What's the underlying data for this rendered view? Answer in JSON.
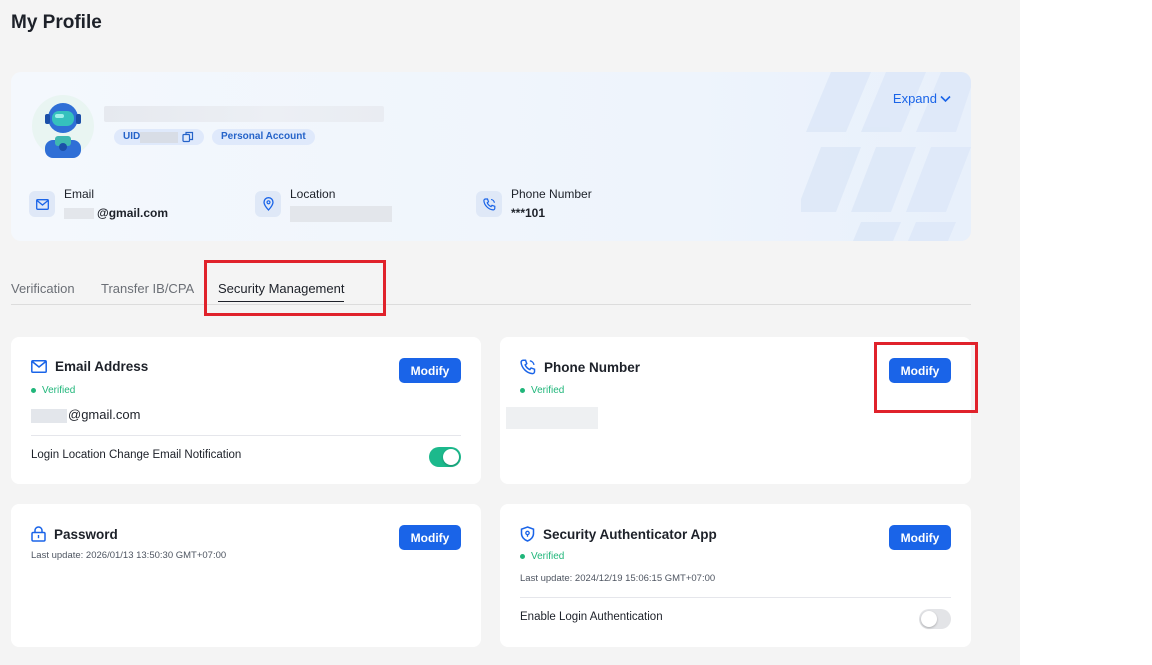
{
  "page": {
    "title": "My Profile"
  },
  "profile": {
    "uid_label": "UID",
    "account_type": "Personal Account",
    "expand_label": "Expand",
    "email": {
      "label": "Email",
      "value": "@gmail.com"
    },
    "location": {
      "label": "Location"
    },
    "phone": {
      "label": "Phone Number",
      "value": "***101"
    }
  },
  "tabs": [
    {
      "label": "Verification"
    },
    {
      "label": "Transfer IB/CPA"
    },
    {
      "label": "Security Management",
      "active": true
    }
  ],
  "security": {
    "email_card": {
      "title": "Email Address",
      "status": "Verified",
      "value": "@gmail.com",
      "button": "Modify",
      "setting_label": "Login Location Change Email Notification",
      "setting_on": true
    },
    "phone_card": {
      "title": "Phone Number",
      "status": "Verified",
      "button": "Modify"
    },
    "password_card": {
      "title": "Password",
      "last_update": "Last update: 2026/01/13 13:50:30 GMT+07:00",
      "button": "Modify"
    },
    "authenticator_card": {
      "title": "Security Authenticator App",
      "status": "Verified",
      "last_update": "Last update: 2024/12/19 15:06:15 GMT+07:00",
      "button": "Modify",
      "setting_label": "Enable Login Authentication",
      "setting_on": false
    }
  },
  "colors": {
    "accent": "#1a64e8",
    "verified": "#20b67a",
    "toggle_on": "#1cb98c",
    "highlight": "#e0222b"
  }
}
